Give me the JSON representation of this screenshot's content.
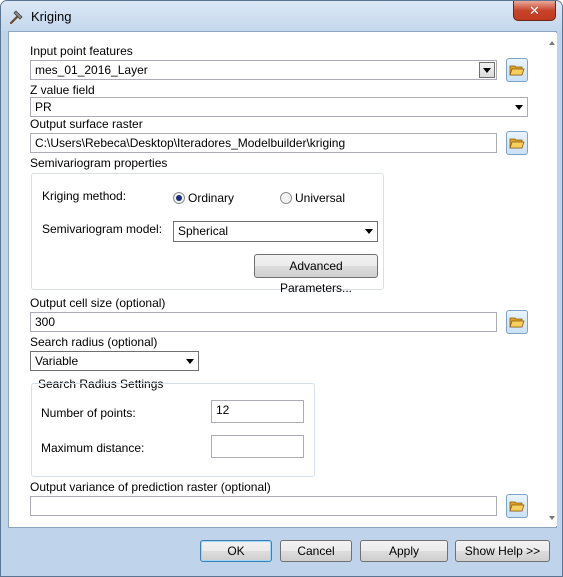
{
  "window": {
    "title": "Kriging",
    "close_symbol": "✕"
  },
  "fields": {
    "input_point_features": {
      "label": "Input point features",
      "value": "mes_01_2016_Layer"
    },
    "z_value_field": {
      "label": "Z value field",
      "value": "PR"
    },
    "output_surface_raster": {
      "label": "Output surface raster",
      "value": "C:\\Users\\Rebeca\\Desktop\\Iteradores_Modelbuilder\\kriging"
    },
    "semivariogram_properties": {
      "label": "Semivariogram properties"
    },
    "kriging_method": {
      "label": "Kriging method:",
      "options": [
        {
          "label": "Ordinary",
          "selected": true
        },
        {
          "label": "Universal",
          "selected": false
        }
      ]
    },
    "semivariogram_model": {
      "label": "Semivariogram model:",
      "value": "Spherical"
    },
    "advanced_parameters": {
      "label": "Advanced Parameters..."
    },
    "output_cell_size": {
      "label": "Output cell size (optional)",
      "value": "300"
    },
    "search_radius": {
      "label": "Search radius (optional)",
      "value": "Variable"
    },
    "search_radius_settings": {
      "label": "Search Radius Settings",
      "number_of_points": {
        "label": "Number of points:",
        "value": "12"
      },
      "maximum_distance": {
        "label": "Maximum distance:",
        "value": ""
      }
    },
    "output_variance": {
      "label": "Output variance of prediction raster (optional)",
      "value": ""
    }
  },
  "buttons": {
    "ok": "OK",
    "cancel": "Cancel",
    "apply": "Apply",
    "show_help": "Show Help >>"
  },
  "colors": {
    "window_frame": "#bfd4ea",
    "close_button": "#c7432a",
    "default_button_border": "#3c7fb1"
  },
  "icons": {
    "title": "hammer-icon",
    "browse": "open-folder-icon"
  }
}
